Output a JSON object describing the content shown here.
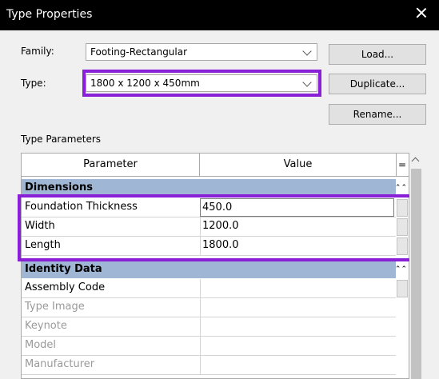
{
  "window": {
    "title": "Type Properties"
  },
  "family": {
    "label": "Family:",
    "value": "Footing-Rectangular"
  },
  "type": {
    "label": "Type:",
    "value": "1800 x 1200 x 450mm"
  },
  "buttons": {
    "load": "Load...",
    "duplicate": "Duplicate...",
    "rename": "Rename..."
  },
  "section": {
    "label": "Type Parameters"
  },
  "table": {
    "headers": {
      "parameter": "Parameter",
      "value": "Value",
      "eq": "="
    },
    "groups": [
      {
        "name": "Dimensions",
        "rows": [
          {
            "parameter": "Foundation Thickness",
            "value": "450.0"
          },
          {
            "parameter": "Width",
            "value": "1200.0"
          },
          {
            "parameter": "Length",
            "value": "1800.0"
          }
        ]
      },
      {
        "name": "Identity Data",
        "rows": [
          {
            "parameter": "Assembly Code",
            "value": ""
          },
          {
            "parameter": "Type Image",
            "value": ""
          },
          {
            "parameter": "Keynote",
            "value": ""
          },
          {
            "parameter": "Model",
            "value": ""
          },
          {
            "parameter": "Manufacturer",
            "value": ""
          }
        ]
      }
    ],
    "collapse_glyph": "⌃⌃"
  },
  "colors": {
    "highlight": "#8a1fd8",
    "group_header": "#9fb7d4",
    "titlebar": "#000000"
  }
}
